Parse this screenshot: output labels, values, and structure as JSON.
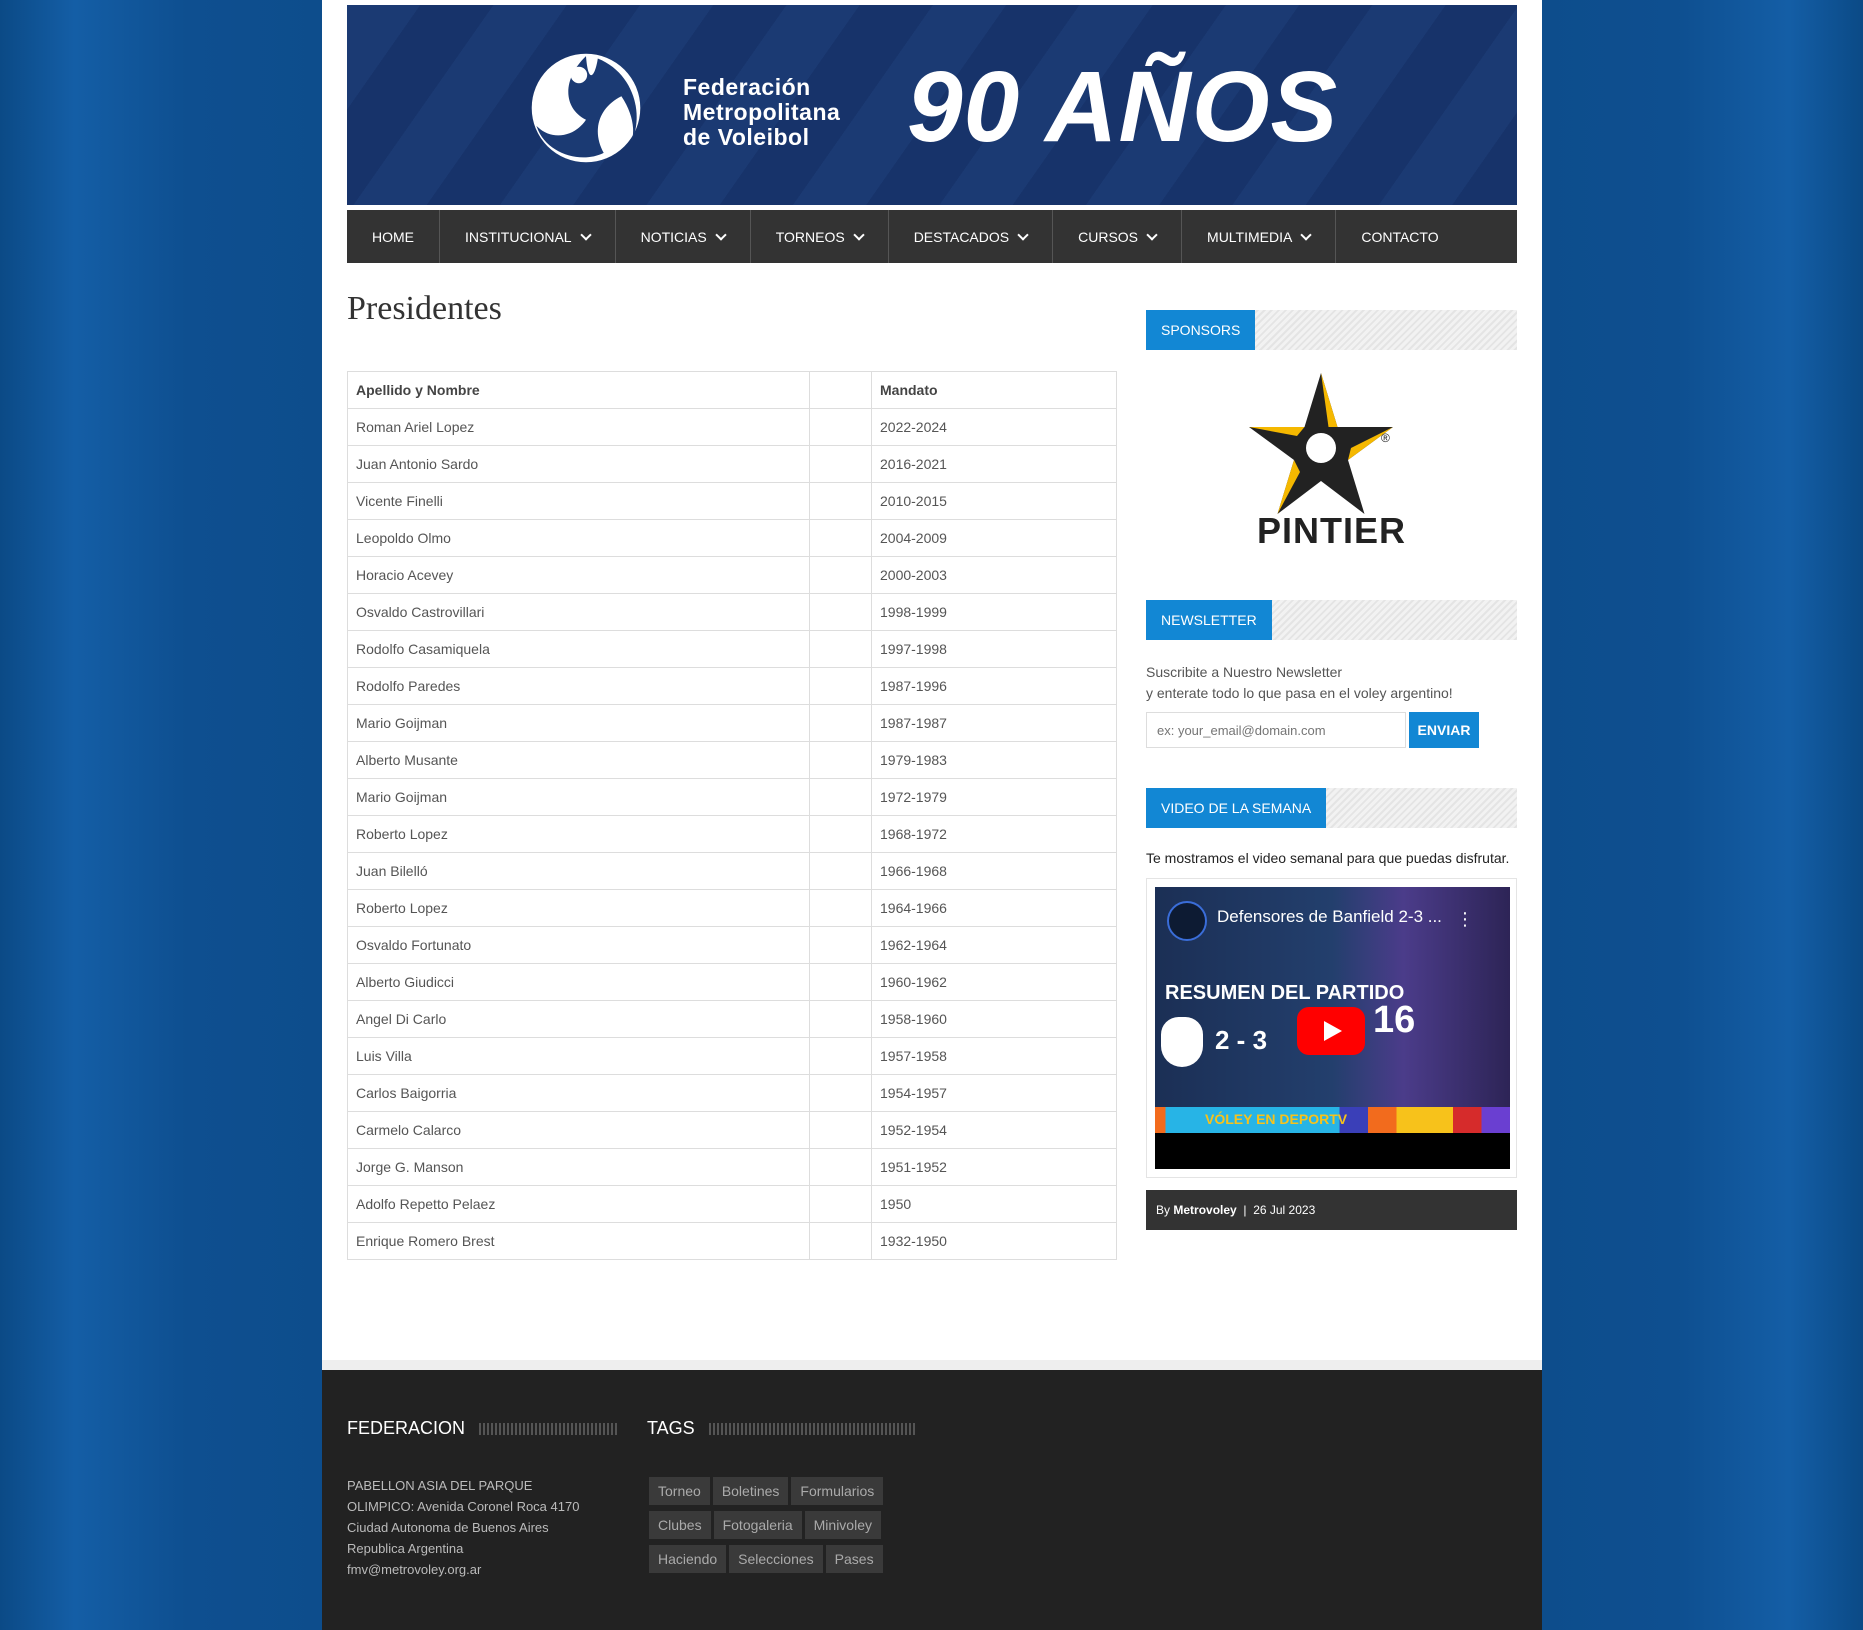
{
  "banner": {
    "line1": "Federación",
    "line2": "Metropolitana",
    "line3": "de Voleibol",
    "anniversary": "90 AÑOS"
  },
  "nav": {
    "items": [
      {
        "label": "HOME",
        "dropdown": false
      },
      {
        "label": "INSTITUCIONAL",
        "dropdown": true
      },
      {
        "label": "NOTICIAS",
        "dropdown": true
      },
      {
        "label": "TORNEOS",
        "dropdown": true
      },
      {
        "label": "DESTACADOS",
        "dropdown": true
      },
      {
        "label": "CURSOS",
        "dropdown": true
      },
      {
        "label": "MULTIMEDIA",
        "dropdown": true
      },
      {
        "label": "CONTACTO",
        "dropdown": false
      }
    ]
  },
  "page": {
    "title": "Presidentes"
  },
  "table": {
    "headers": [
      "Apellido y Nombre",
      "",
      "Mandato"
    ],
    "rows": [
      [
        "Roman Ariel Lopez",
        "2022-2024"
      ],
      [
        "Juan Antonio Sardo",
        "2016-2021"
      ],
      [
        "Vicente Finelli",
        "2010-2015"
      ],
      [
        "Leopoldo Olmo",
        "2004-2009"
      ],
      [
        "Horacio Acevey",
        "2000-2003"
      ],
      [
        "Osvaldo Castrovillari",
        "1998-1999"
      ],
      [
        "Rodolfo Casamiquela",
        "1997-1998"
      ],
      [
        "Rodolfo Paredes",
        "1987-1996"
      ],
      [
        "Mario Goijman",
        "1987-1987"
      ],
      [
        "Alberto Musante",
        "1979-1983"
      ],
      [
        "Mario Goijman",
        "1972-1979"
      ],
      [
        "Roberto Lopez",
        "1968-1972"
      ],
      [
        "Juan Bilelló",
        "1966-1968"
      ],
      [
        "Roberto Lopez",
        "1964-1966"
      ],
      [
        "Osvaldo Fortunato",
        "1962-1964"
      ],
      [
        "Alberto Giudicci",
        "1960-1962"
      ],
      [
        "Angel Di Carlo",
        "1958-1960"
      ],
      [
        "Luis Villa",
        "1957-1958"
      ],
      [
        "Carlos Baigorria",
        "1954-1957"
      ],
      [
        "Carmelo Calarco",
        "1952-1954"
      ],
      [
        "Jorge G. Manson",
        "1951-1952"
      ],
      [
        "Adolfo Repetto Pelaez",
        "1950"
      ],
      [
        "Enrique Romero Brest",
        "1932-1950"
      ]
    ]
  },
  "sidebar": {
    "sponsors": {
      "title": "SPONSORS",
      "brand": "PINTIER"
    },
    "newsletter": {
      "title": "NEWSLETTER",
      "line1": "Suscribite a Nuestro Newsletter",
      "line2": "y enterate todo lo que pasa en el voley argentino!",
      "placeholder": "ex: your_email@domain.com",
      "button": "ENVIAR"
    },
    "video": {
      "title": "VIDEO DE LA SEMANA",
      "description": "Te mostramos el video semanal para que puedas disfrutar.",
      "video_title": "Defensores de Banfield 2-3 ...",
      "overlay_heading": "RESUMEN DEL PARTIDO",
      "overlay_score": "2 - 3",
      "overlay_number": "16",
      "strip_text": "VÓLEY EN DEPORTV",
      "meta_by": "By",
      "meta_author": "Metrovoley",
      "meta_sep": "|",
      "meta_date": "26 Jul 2023"
    }
  },
  "footer": {
    "federacion": {
      "title": "FEDERACION",
      "lines": [
        "PABELLON ASIA DEL PARQUE",
        "OLIMPICO: Avenida Coronel Roca 4170",
        "Ciudad Autonoma de Buenos Aires",
        "Republica Argentina",
        "fmv@metrovoley.org.ar"
      ]
    },
    "tags": {
      "title": "TAGS",
      "items": [
        "Torneo",
        "Boletines",
        "Formularios",
        "Clubes",
        "Fotogaleria",
        "Minivoley",
        "Haciendo",
        "Selecciones",
        "Pases"
      ]
    }
  },
  "colors": {
    "accent": "#1287d4",
    "banner": "#1b3a73",
    "nav": "#333333",
    "footer": "#222222",
    "background": "#0d4d8c"
  }
}
